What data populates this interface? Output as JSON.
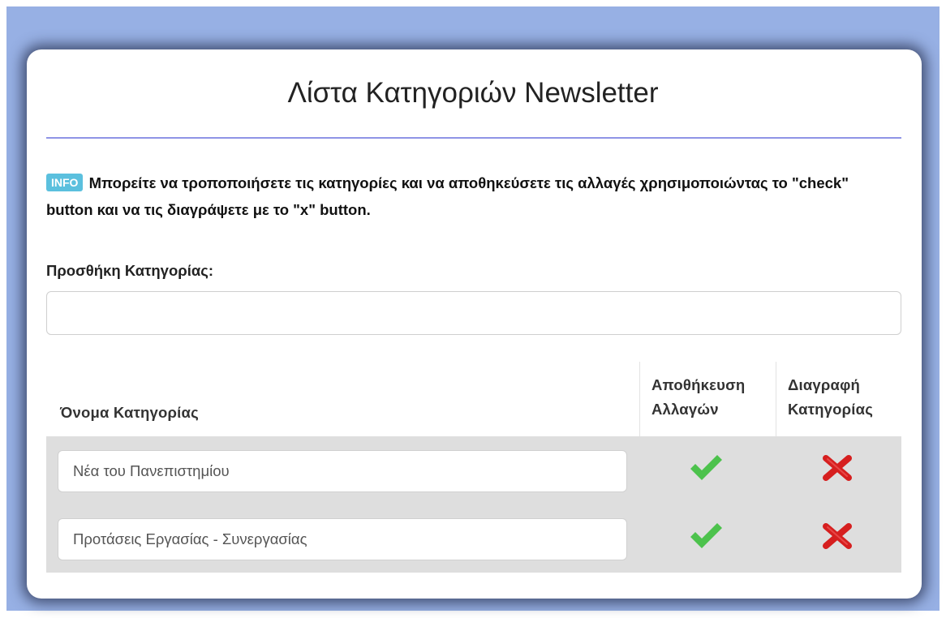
{
  "card": {
    "title": "Λίστα Κατηγοριών Newsletter"
  },
  "info": {
    "badge": "INFO",
    "text": "Μπορείτε να τροποποιήσετε τις κατηγορίες και να αποθηκεύσετε τις αλλαγές χρησιμοποιώντας το \"check\" button και να τις διαγράψετε με το \"x\" button."
  },
  "add_category": {
    "label": "Προσθήκη Κατηγορίας:",
    "value": "",
    "placeholder": ""
  },
  "table": {
    "headers": {
      "name": "Όνομα Κατηγορίας",
      "save_line1": "Αποθήκευση",
      "save_line2": "Αλλαγών",
      "delete_line1": "Διαγραφή",
      "delete_line2": "Κατηγορίας"
    },
    "rows": [
      {
        "name": "Νέα του Πανεπιστημίου",
        "save_icon": "check-icon",
        "delete_icon": "x-icon"
      },
      {
        "name": "Προτάσεις Εργασίας - Συνεργασίας",
        "save_icon": "check-icon",
        "delete_icon": "x-icon"
      }
    ]
  },
  "colors": {
    "backdrop": "#97b0e4",
    "info_badge": "#5bc0de",
    "title_rule": "#8f94e6",
    "check_icon": "#4cc24c",
    "x_icon": "#d61f1f",
    "table_body": "#dedede"
  }
}
